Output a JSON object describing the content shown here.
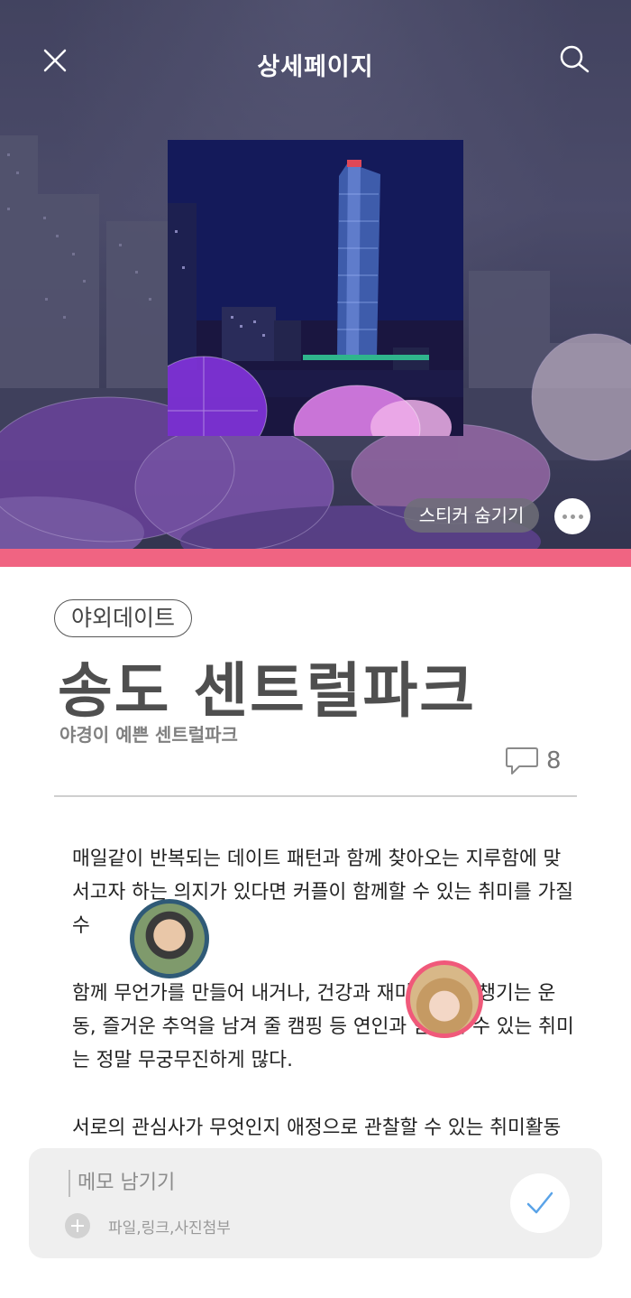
{
  "header": {
    "title": "상세페이지",
    "close_icon": "close-icon",
    "search_icon": "search-icon"
  },
  "hero": {
    "sticker_hide_label": "스티커 숨기기",
    "more_icon": "more-dots-icon",
    "accent_color": "#f06482"
  },
  "article": {
    "tag": "야외데이트",
    "title": "송도 센트럴파크",
    "subtitle": "야경이 예쁜 센트럴파크",
    "comment_count": "8",
    "paragraphs": [
      "매일같이 반복되는 데이트 패턴과 함께 찾아오는 지루함에 맞서고자 하는 의지가 있다면 커플이 함께할 수 있는 취미를 가질 수",
      "함께 무언가를 만들어 내거나, 건강과 재미를 함께 챙기는 운동, 즐거운 추억을 남겨 줄 캠핑 등 연인과 함께할 수 있는 취미는 정말 무궁무진하게 많다.",
      "서로의 관심사가 무엇인지 애정으로 관찰할 수 있는 취미활동"
    ]
  },
  "memo": {
    "placeholder": "메모 남기기",
    "attach_label": "파일,링크,사진첨부",
    "submit_icon": "check-icon"
  }
}
